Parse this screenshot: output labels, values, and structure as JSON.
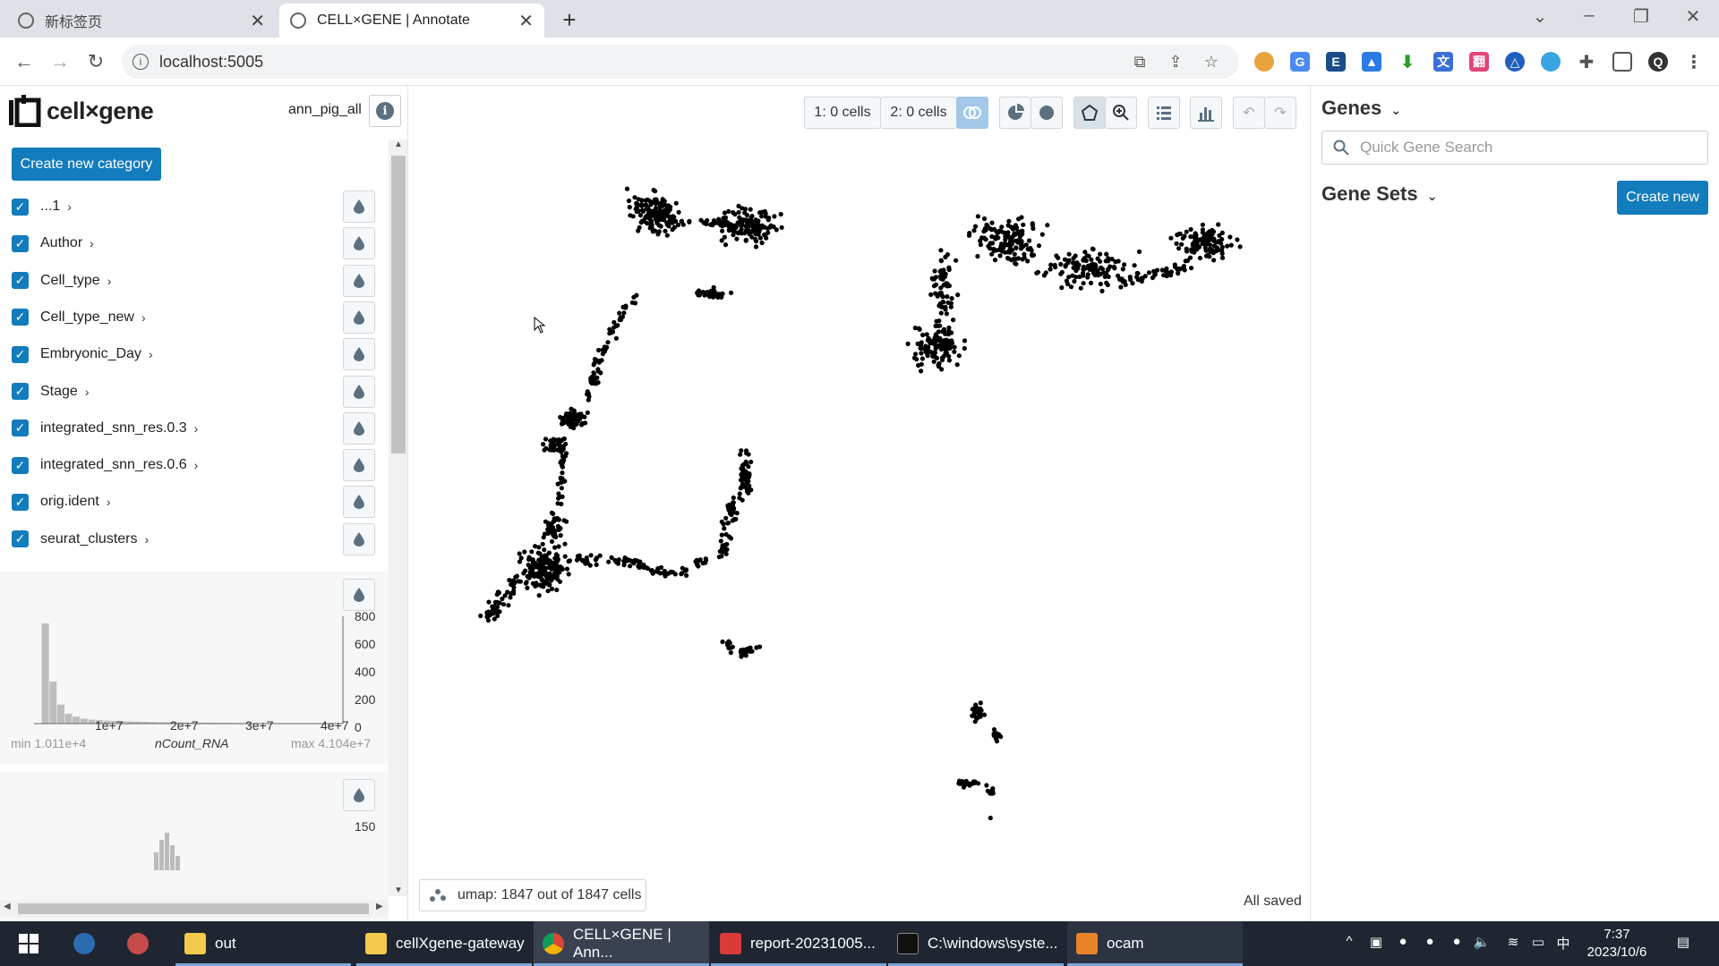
{
  "browser": {
    "tabs": [
      {
        "title": "新标签页",
        "active": false
      },
      {
        "title": "CELL×GENE | Annotate",
        "active": true
      }
    ],
    "url": "localhost:5005"
  },
  "app": {
    "logo_text": "cell×gene",
    "dataset_name": "ann_pig_all",
    "create_category_label": "Create new category",
    "categories": [
      {
        "label": "...1",
        "checked": true
      },
      {
        "label": "Author",
        "checked": true
      },
      {
        "label": "Cell_type",
        "checked": true
      },
      {
        "label": "Cell_type_new",
        "checked": true
      },
      {
        "label": "Embryonic_Day",
        "checked": true
      },
      {
        "label": "Stage",
        "checked": true
      },
      {
        "label": "integrated_snn_res.0.3",
        "checked": true
      },
      {
        "label": "integrated_snn_res.0.6",
        "checked": true
      },
      {
        "label": "orig.ident",
        "checked": true
      },
      {
        "label": "seurat_clusters",
        "checked": true
      }
    ],
    "histogram1": {
      "field": "nCount_RNA",
      "min_label": "min 1.011e+4",
      "max_label": "max 4.104e+7",
      "y_ticks": [
        "800",
        "600",
        "400",
        "200",
        "0"
      ],
      "x_ticks": [
        "1e+7",
        "2e+7",
        "3e+7",
        "4e+7"
      ],
      "bar_heights": [
        0.0,
        1.0,
        0.42,
        0.19,
        0.1,
        0.07,
        0.05,
        0.04,
        0.035,
        0.03,
        0.028,
        0.024,
        0.022,
        0.02,
        0.018,
        0.016,
        0.014,
        0.014,
        0.013,
        0.012,
        0.011,
        0.01,
        0.01,
        0.009,
        0.008,
        0.008,
        0.006,
        0.005,
        0.004,
        0.004,
        0.003,
        0.003,
        0.003,
        0.002,
        0.002,
        0.002,
        0.001,
        0.001,
        0.001,
        0.001
      ]
    },
    "histogram2": {
      "y_tick_top": "150"
    },
    "toolbar": {
      "select1_label": "1: 0 cells",
      "select2_label": "2: 0 cells"
    },
    "embedding_info": "umap: 1847 out of 1847 cells",
    "save_status": "All saved",
    "genes_title": "Genes",
    "gene_search_placeholder": "Quick Gene Search",
    "gene_sets_title": "Gene Sets",
    "create_new_label": "Create new",
    "accent_color": "#137cbd"
  },
  "taskbar": {
    "items": [
      {
        "label": "out"
      },
      {
        "label": "cellXgene-gateway"
      },
      {
        "label": "CELL×GENE | Ann..."
      },
      {
        "label": "report-20231005..."
      },
      {
        "label": "C:\\windows\\syste..."
      },
      {
        "label": "ocam"
      }
    ],
    "ime": "中",
    "time": "7:37",
    "date": "2023/10/6"
  }
}
